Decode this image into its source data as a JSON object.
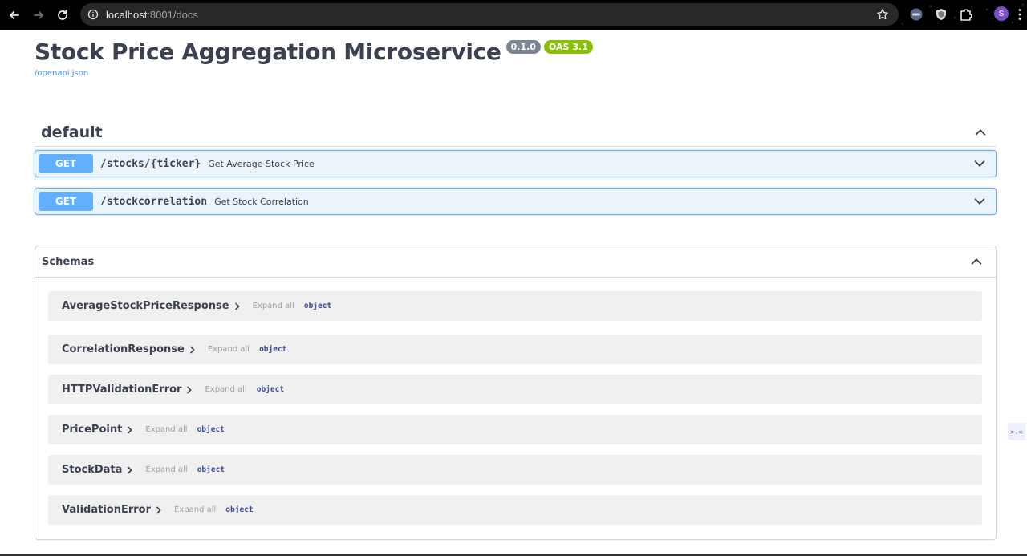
{
  "browser": {
    "url_host": "localhost",
    "url_rest": ":8001/docs",
    "profile_initial": "S"
  },
  "header": {
    "title": "Stock Price Aggregation Microservice",
    "version_badge": "0.1.0",
    "oas_badge": "OAS 3.1",
    "openapi_link": "/openapi.json"
  },
  "tag": {
    "name": "default",
    "operations": [
      {
        "method": "GET",
        "path": "/stocks/{ticker}",
        "summary": "Get Average Stock Price"
      },
      {
        "method": "GET",
        "path": "/stockcorrelation",
        "summary": "Get Stock Correlation"
      }
    ]
  },
  "schemas": {
    "title": "Schemas",
    "models": [
      {
        "name": "AverageStockPriceResponse",
        "expand": "Expand all",
        "type": "object"
      },
      {
        "name": "CorrelationResponse",
        "expand": "Expand all",
        "type": "object"
      },
      {
        "name": "HTTPValidationError",
        "expand": "Expand all",
        "type": "object"
      },
      {
        "name": "PricePoint",
        "expand": "Expand all",
        "type": "object"
      },
      {
        "name": "StockData",
        "expand": "Expand all",
        "type": "object"
      },
      {
        "name": "ValidationError",
        "expand": "Expand all",
        "type": "object"
      }
    ]
  },
  "side_widget": {
    "label": ">.<"
  },
  "colors": {
    "get_method": "#61affe",
    "get_block_bg": "#ebf3fb",
    "version_badge": "#7d8492",
    "oas_badge": "#89bf04",
    "link": "#4990e2",
    "schema_type": "#3b4b94"
  },
  "icons": [
    "back-arrow-icon",
    "forward-arrow-icon",
    "reload-icon",
    "site-info-icon",
    "bookmark-star-icon",
    "extension-icon",
    "shield-icon",
    "puzzle-icon",
    "chevron-up-icon",
    "chevron-down-icon",
    "chevron-right-icon"
  ]
}
